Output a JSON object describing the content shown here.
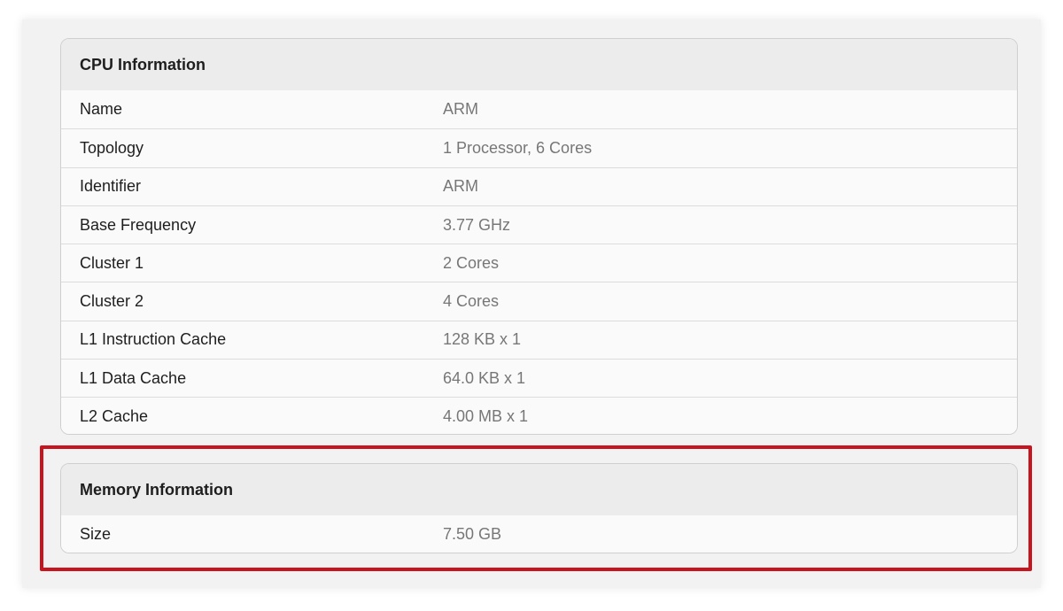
{
  "cpu": {
    "title": "CPU Information",
    "rows": [
      {
        "label": "Name",
        "value": "ARM"
      },
      {
        "label": "Topology",
        "value": "1 Processor, 6 Cores"
      },
      {
        "label": "Identifier",
        "value": "ARM"
      },
      {
        "label": "Base Frequency",
        "value": "3.77 GHz"
      },
      {
        "label": "Cluster 1",
        "value": "2 Cores"
      },
      {
        "label": "Cluster 2",
        "value": "4 Cores"
      },
      {
        "label": "L1 Instruction Cache",
        "value": "128 KB x 1"
      },
      {
        "label": "L1 Data Cache",
        "value": "64.0 KB x 1"
      },
      {
        "label": "L2 Cache",
        "value": "4.00 MB x 1"
      }
    ]
  },
  "memory": {
    "title": "Memory Information",
    "rows": [
      {
        "label": "Size",
        "value": "7.50 GB"
      }
    ]
  },
  "colors": {
    "highlight": "#c8141e"
  }
}
